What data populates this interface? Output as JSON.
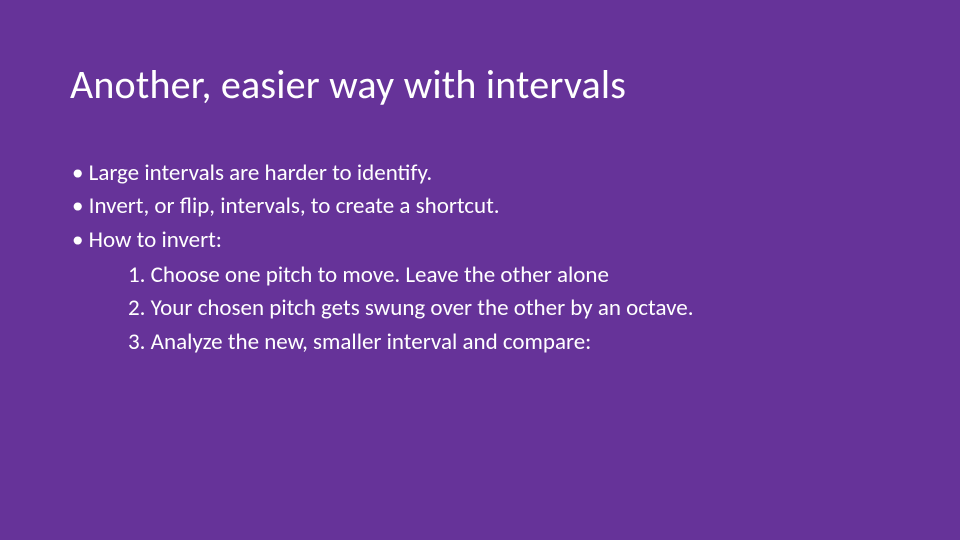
{
  "slide": {
    "title": "Another, easier way with intervals",
    "bullets": [
      "Large intervals are harder to identify.",
      "Invert, or flip, intervals, to create a shortcut.",
      "How to invert:"
    ],
    "steps": [
      {
        "num": "1.",
        "text": "Choose one pitch to move. Leave the other alone"
      },
      {
        "num": "2.",
        "text": "Your chosen pitch gets swung over the other by an octave."
      },
      {
        "num": "3.",
        "text": "Analyze the new, smaller interval and compare:"
      }
    ]
  }
}
